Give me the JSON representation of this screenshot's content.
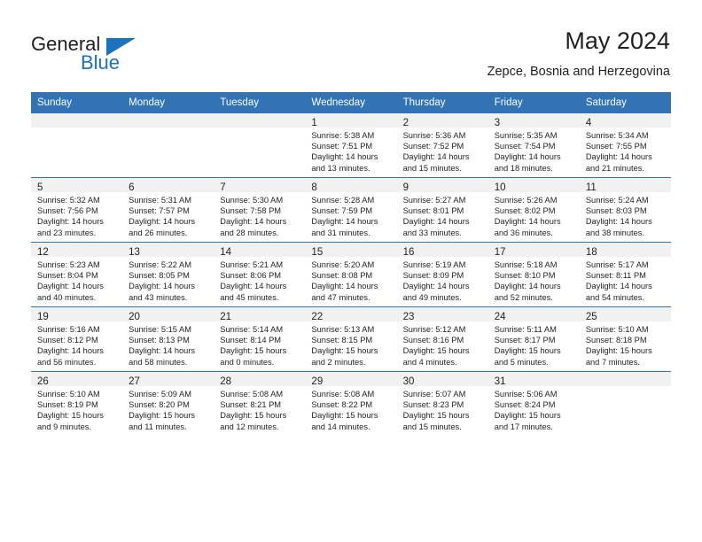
{
  "logo": {
    "word_top": "General",
    "word_bottom": "Blue",
    "accent_color": "#1c72bb",
    "icon": "triangle-icon"
  },
  "header": {
    "title": "May 2024",
    "subtitle": "Zepce, Bosnia and Herzegovina"
  },
  "theme": {
    "header_row_bg": "#3173b4",
    "daynum_band_bg": "#f1f1f1",
    "grid_line": "#3173b4",
    "text": "#231f20"
  },
  "weekday_headers": [
    "Sunday",
    "Monday",
    "Tuesday",
    "Wednesday",
    "Thursday",
    "Friday",
    "Saturday"
  ],
  "weeks": [
    [
      {
        "day": "",
        "lines": [
          "",
          "",
          "",
          ""
        ]
      },
      {
        "day": "",
        "lines": [
          "",
          "",
          "",
          ""
        ]
      },
      {
        "day": "",
        "lines": [
          "",
          "",
          "",
          ""
        ]
      },
      {
        "day": "1",
        "lines": [
          "Sunrise: 5:38 AM",
          "Sunset: 7:51 PM",
          "Daylight: 14 hours",
          "and 13 minutes."
        ]
      },
      {
        "day": "2",
        "lines": [
          "Sunrise: 5:36 AM",
          "Sunset: 7:52 PM",
          "Daylight: 14 hours",
          "and 15 minutes."
        ]
      },
      {
        "day": "3",
        "lines": [
          "Sunrise: 5:35 AM",
          "Sunset: 7:54 PM",
          "Daylight: 14 hours",
          "and 18 minutes."
        ]
      },
      {
        "day": "4",
        "lines": [
          "Sunrise: 5:34 AM",
          "Sunset: 7:55 PM",
          "Daylight: 14 hours",
          "and 21 minutes."
        ]
      }
    ],
    [
      {
        "day": "5",
        "lines": [
          "Sunrise: 5:32 AM",
          "Sunset: 7:56 PM",
          "Daylight: 14 hours",
          "and 23 minutes."
        ]
      },
      {
        "day": "6",
        "lines": [
          "Sunrise: 5:31 AM",
          "Sunset: 7:57 PM",
          "Daylight: 14 hours",
          "and 26 minutes."
        ]
      },
      {
        "day": "7",
        "lines": [
          "Sunrise: 5:30 AM",
          "Sunset: 7:58 PM",
          "Daylight: 14 hours",
          "and 28 minutes."
        ]
      },
      {
        "day": "8",
        "lines": [
          "Sunrise: 5:28 AM",
          "Sunset: 7:59 PM",
          "Daylight: 14 hours",
          "and 31 minutes."
        ]
      },
      {
        "day": "9",
        "lines": [
          "Sunrise: 5:27 AM",
          "Sunset: 8:01 PM",
          "Daylight: 14 hours",
          "and 33 minutes."
        ]
      },
      {
        "day": "10",
        "lines": [
          "Sunrise: 5:26 AM",
          "Sunset: 8:02 PM",
          "Daylight: 14 hours",
          "and 36 minutes."
        ]
      },
      {
        "day": "11",
        "lines": [
          "Sunrise: 5:24 AM",
          "Sunset: 8:03 PM",
          "Daylight: 14 hours",
          "and 38 minutes."
        ]
      }
    ],
    [
      {
        "day": "12",
        "lines": [
          "Sunrise: 5:23 AM",
          "Sunset: 8:04 PM",
          "Daylight: 14 hours",
          "and 40 minutes."
        ]
      },
      {
        "day": "13",
        "lines": [
          "Sunrise: 5:22 AM",
          "Sunset: 8:05 PM",
          "Daylight: 14 hours",
          "and 43 minutes."
        ]
      },
      {
        "day": "14",
        "lines": [
          "Sunrise: 5:21 AM",
          "Sunset: 8:06 PM",
          "Daylight: 14 hours",
          "and 45 minutes."
        ]
      },
      {
        "day": "15",
        "lines": [
          "Sunrise: 5:20 AM",
          "Sunset: 8:08 PM",
          "Daylight: 14 hours",
          "and 47 minutes."
        ]
      },
      {
        "day": "16",
        "lines": [
          "Sunrise: 5:19 AM",
          "Sunset: 8:09 PM",
          "Daylight: 14 hours",
          "and 49 minutes."
        ]
      },
      {
        "day": "17",
        "lines": [
          "Sunrise: 5:18 AM",
          "Sunset: 8:10 PM",
          "Daylight: 14 hours",
          "and 52 minutes."
        ]
      },
      {
        "day": "18",
        "lines": [
          "Sunrise: 5:17 AM",
          "Sunset: 8:11 PM",
          "Daylight: 14 hours",
          "and 54 minutes."
        ]
      }
    ],
    [
      {
        "day": "19",
        "lines": [
          "Sunrise: 5:16 AM",
          "Sunset: 8:12 PM",
          "Daylight: 14 hours",
          "and 56 minutes."
        ]
      },
      {
        "day": "20",
        "lines": [
          "Sunrise: 5:15 AM",
          "Sunset: 8:13 PM",
          "Daylight: 14 hours",
          "and 58 minutes."
        ]
      },
      {
        "day": "21",
        "lines": [
          "Sunrise: 5:14 AM",
          "Sunset: 8:14 PM",
          "Daylight: 15 hours",
          "and 0 minutes."
        ]
      },
      {
        "day": "22",
        "lines": [
          "Sunrise: 5:13 AM",
          "Sunset: 8:15 PM",
          "Daylight: 15 hours",
          "and 2 minutes."
        ]
      },
      {
        "day": "23",
        "lines": [
          "Sunrise: 5:12 AM",
          "Sunset: 8:16 PM",
          "Daylight: 15 hours",
          "and 4 minutes."
        ]
      },
      {
        "day": "24",
        "lines": [
          "Sunrise: 5:11 AM",
          "Sunset: 8:17 PM",
          "Daylight: 15 hours",
          "and 5 minutes."
        ]
      },
      {
        "day": "25",
        "lines": [
          "Sunrise: 5:10 AM",
          "Sunset: 8:18 PM",
          "Daylight: 15 hours",
          "and 7 minutes."
        ]
      }
    ],
    [
      {
        "day": "26",
        "lines": [
          "Sunrise: 5:10 AM",
          "Sunset: 8:19 PM",
          "Daylight: 15 hours",
          "and 9 minutes."
        ]
      },
      {
        "day": "27",
        "lines": [
          "Sunrise: 5:09 AM",
          "Sunset: 8:20 PM",
          "Daylight: 15 hours",
          "and 11 minutes."
        ]
      },
      {
        "day": "28",
        "lines": [
          "Sunrise: 5:08 AM",
          "Sunset: 8:21 PM",
          "Daylight: 15 hours",
          "and 12 minutes."
        ]
      },
      {
        "day": "29",
        "lines": [
          "Sunrise: 5:08 AM",
          "Sunset: 8:22 PM",
          "Daylight: 15 hours",
          "and 14 minutes."
        ]
      },
      {
        "day": "30",
        "lines": [
          "Sunrise: 5:07 AM",
          "Sunset: 8:23 PM",
          "Daylight: 15 hours",
          "and 15 minutes."
        ]
      },
      {
        "day": "31",
        "lines": [
          "Sunrise: 5:06 AM",
          "Sunset: 8:24 PM",
          "Daylight: 15 hours",
          "and 17 minutes."
        ]
      },
      {
        "day": "",
        "lines": [
          "",
          "",
          "",
          ""
        ]
      }
    ]
  ]
}
